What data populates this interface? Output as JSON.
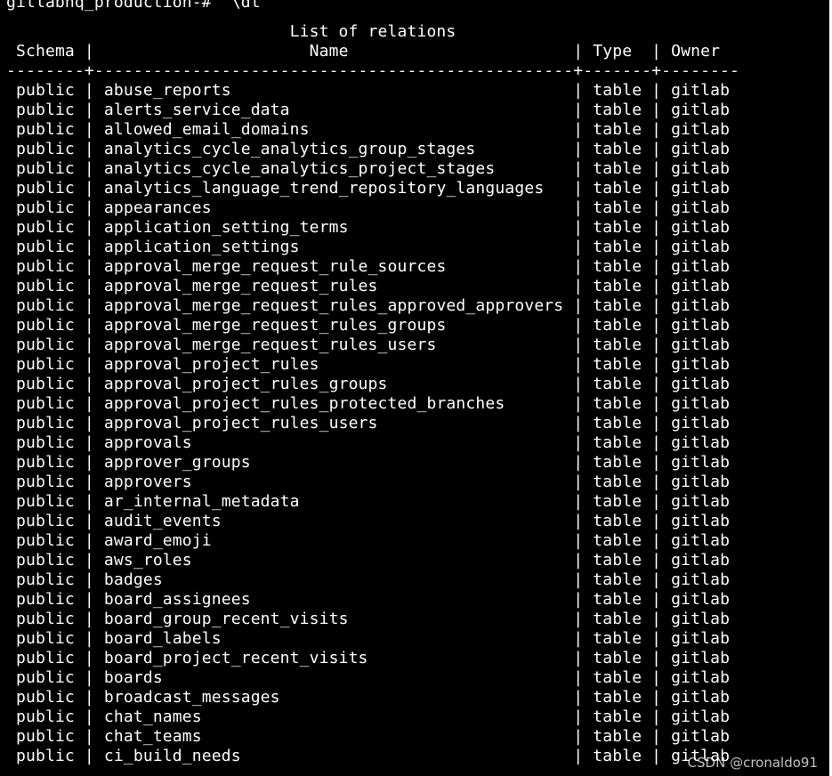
{
  "terminal": {
    "prompt": "gitlabhq_production-#",
    "command": "\\dt",
    "title": "List of relations",
    "columns": [
      "Schema",
      "Name",
      "Type",
      "Owner"
    ],
    "rows": [
      [
        "public",
        "abuse_reports",
        "table",
        "gitlab"
      ],
      [
        "public",
        "alerts_service_data",
        "table",
        "gitlab"
      ],
      [
        "public",
        "allowed_email_domains",
        "table",
        "gitlab"
      ],
      [
        "public",
        "analytics_cycle_analytics_group_stages",
        "table",
        "gitlab"
      ],
      [
        "public",
        "analytics_cycle_analytics_project_stages",
        "table",
        "gitlab"
      ],
      [
        "public",
        "analytics_language_trend_repository_languages",
        "table",
        "gitlab"
      ],
      [
        "public",
        "appearances",
        "table",
        "gitlab"
      ],
      [
        "public",
        "application_setting_terms",
        "table",
        "gitlab"
      ],
      [
        "public",
        "application_settings",
        "table",
        "gitlab"
      ],
      [
        "public",
        "approval_merge_request_rule_sources",
        "table",
        "gitlab"
      ],
      [
        "public",
        "approval_merge_request_rules",
        "table",
        "gitlab"
      ],
      [
        "public",
        "approval_merge_request_rules_approved_approvers",
        "table",
        "gitlab"
      ],
      [
        "public",
        "approval_merge_request_rules_groups",
        "table",
        "gitlab"
      ],
      [
        "public",
        "approval_merge_request_rules_users",
        "table",
        "gitlab"
      ],
      [
        "public",
        "approval_project_rules",
        "table",
        "gitlab"
      ],
      [
        "public",
        "approval_project_rules_groups",
        "table",
        "gitlab"
      ],
      [
        "public",
        "approval_project_rules_protected_branches",
        "table",
        "gitlab"
      ],
      [
        "public",
        "approval_project_rules_users",
        "table",
        "gitlab"
      ],
      [
        "public",
        "approvals",
        "table",
        "gitlab"
      ],
      [
        "public",
        "approver_groups",
        "table",
        "gitlab"
      ],
      [
        "public",
        "approvers",
        "table",
        "gitlab"
      ],
      [
        "public",
        "ar_internal_metadata",
        "table",
        "gitlab"
      ],
      [
        "public",
        "audit_events",
        "table",
        "gitlab"
      ],
      [
        "public",
        "award_emoji",
        "table",
        "gitlab"
      ],
      [
        "public",
        "aws_roles",
        "table",
        "gitlab"
      ],
      [
        "public",
        "badges",
        "table",
        "gitlab"
      ],
      [
        "public",
        "board_assignees",
        "table",
        "gitlab"
      ],
      [
        "public",
        "board_group_recent_visits",
        "table",
        "gitlab"
      ],
      [
        "public",
        "board_labels",
        "table",
        "gitlab"
      ],
      [
        "public",
        "board_project_recent_visits",
        "table",
        "gitlab"
      ],
      [
        "public",
        "boards",
        "table",
        "gitlab"
      ],
      [
        "public",
        "broadcast_messages",
        "table",
        "gitlab"
      ],
      [
        "public",
        "chat_names",
        "table",
        "gitlab"
      ],
      [
        "public",
        "chat_teams",
        "table",
        "gitlab"
      ],
      [
        "public",
        "ci_build_needs",
        "table",
        "gitlab"
      ]
    ]
  },
  "watermark": "CSDN @cronaldo91",
  "colors": {
    "background": "#000000",
    "text": "#ffffff"
  }
}
